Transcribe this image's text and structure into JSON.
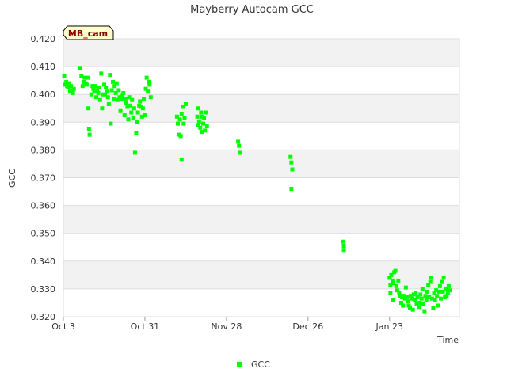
{
  "chart_data": {
    "type": "scatter",
    "title": "Mayberry Autocam GCC",
    "xlabel": "Time",
    "ylabel": "GCC",
    "tag_label": "MB_cam",
    "ylim": [
      0.32,
      0.42
    ],
    "yticks": [
      "0.420",
      "0.410",
      "0.400",
      "0.390",
      "0.380",
      "0.370",
      "0.360",
      "0.350",
      "0.340",
      "0.330",
      "0.320"
    ],
    "xlim_days": [
      0,
      136
    ],
    "xticks": [
      {
        "label": "Oct 3",
        "day": 0
      },
      {
        "label": "Oct 31",
        "day": 28
      },
      {
        "label": "Nov 28",
        "day": 56
      },
      {
        "label": "Dec 26",
        "day": 84
      },
      {
        "label": "Jan 23",
        "day": 112
      }
    ],
    "grid": true,
    "legend_position": "bottom",
    "series": [
      {
        "name": "GCC",
        "color": "#00ff00",
        "points": [
          [
            0.3,
            0.4065
          ],
          [
            0.6,
            0.4035
          ],
          [
            1.0,
            0.4045
          ],
          [
            1.3,
            0.403
          ],
          [
            1.6,
            0.4025
          ],
          [
            2.0,
            0.404
          ],
          [
            2.3,
            0.401
          ],
          [
            2.6,
            0.403
          ],
          [
            3.0,
            0.4015
          ],
          [
            3.3,
            0.4005
          ],
          [
            3.6,
            0.402
          ],
          [
            5.8,
            0.4095
          ],
          [
            6.2,
            0.4065
          ],
          [
            6.6,
            0.403
          ],
          [
            7.0,
            0.4045
          ],
          [
            7.3,
            0.406
          ],
          [
            7.7,
            0.404
          ],
          [
            8.0,
            0.4035
          ],
          [
            8.3,
            0.406
          ],
          [
            8.6,
            0.395
          ],
          [
            8.8,
            0.3875
          ],
          [
            9.0,
            0.3855
          ],
          [
            9.6,
            0.4
          ],
          [
            10.0,
            0.403
          ],
          [
            10.3,
            0.402
          ],
          [
            10.6,
            0.401
          ],
          [
            11.0,
            0.403
          ],
          [
            11.3,
            0.399
          ],
          [
            11.6,
            0.4015
          ],
          [
            12.0,
            0.4005
          ],
          [
            12.3,
            0.4025
          ],
          [
            12.6,
            0.398
          ],
          [
            13.0,
            0.4075
          ],
          [
            13.3,
            0.395
          ],
          [
            13.6,
            0.4
          ],
          [
            14.0,
            0.4035
          ],
          [
            14.3,
            0.4
          ],
          [
            14.6,
            0.4025
          ],
          [
            15.0,
            0.401
          ],
          [
            15.3,
            0.399
          ],
          [
            15.6,
            0.3965
          ],
          [
            16.0,
            0.407
          ],
          [
            16.3,
            0.3895
          ],
          [
            16.6,
            0.4015
          ],
          [
            17.0,
            0.4045
          ],
          [
            17.3,
            0.3985
          ],
          [
            17.6,
            0.403
          ],
          [
            18.0,
            0.4005
          ],
          [
            18.3,
            0.404
          ],
          [
            18.6,
            0.398
          ],
          [
            19.0,
            0.4015
          ],
          [
            19.3,
            0.399
          ],
          [
            19.6,
            0.394
          ],
          [
            20.0,
            0.3985
          ],
          [
            20.3,
            0.3995
          ],
          [
            20.6,
            0.4005
          ],
          [
            21.0,
            0.3925
          ],
          [
            21.3,
            0.3985
          ],
          [
            21.6,
            0.397
          ],
          [
            22.0,
            0.3955
          ],
          [
            22.3,
            0.391
          ],
          [
            22.6,
            0.399
          ],
          [
            23.0,
            0.396
          ],
          [
            23.3,
            0.3935
          ],
          [
            23.6,
            0.398
          ],
          [
            24.0,
            0.3915
          ],
          [
            24.3,
            0.395
          ],
          [
            24.6,
            0.379
          ],
          [
            25.0,
            0.386
          ],
          [
            25.3,
            0.39
          ],
          [
            25.6,
            0.3935
          ],
          [
            26.0,
            0.396
          ],
          [
            26.3,
            0.3975
          ],
          [
            26.6,
            0.3955
          ],
          [
            27.0,
            0.392
          ],
          [
            27.3,
            0.395
          ],
          [
            27.6,
            0.3985
          ],
          [
            28.0,
            0.3925
          ],
          [
            28.3,
            0.402
          ],
          [
            28.6,
            0.406
          ],
          [
            29.0,
            0.401
          ],
          [
            29.3,
            0.4045
          ],
          [
            29.6,
            0.4035
          ],
          [
            30.0,
            0.399
          ],
          [
            39.0,
            0.392
          ],
          [
            39.3,
            0.3895
          ],
          [
            39.6,
            0.3855
          ],
          [
            40.0,
            0.391
          ],
          [
            40.3,
            0.385
          ],
          [
            40.6,
            0.393
          ],
          [
            41.0,
            0.3955
          ],
          [
            41.3,
            0.3895
          ],
          [
            41.6,
            0.3915
          ],
          [
            42.0,
            0.3965
          ],
          [
            40.6,
            0.3765
          ],
          [
            46.0,
            0.392
          ],
          [
            46.3,
            0.395
          ],
          [
            46.6,
            0.39
          ],
          [
            47.0,
            0.388
          ],
          [
            47.3,
            0.3935
          ],
          [
            47.6,
            0.3865
          ],
          [
            48.0,
            0.3895
          ],
          [
            48.3,
            0.3915
          ],
          [
            48.6,
            0.387
          ],
          [
            49.0,
            0.3935
          ],
          [
            49.3,
            0.3885
          ],
          [
            46.3,
            0.389
          ],
          [
            47.6,
            0.392
          ],
          [
            60.0,
            0.383
          ],
          [
            60.3,
            0.3815
          ],
          [
            60.6,
            0.379
          ],
          [
            78.0,
            0.3775
          ],
          [
            78.3,
            0.3755
          ],
          [
            78.6,
            0.373
          ],
          [
            78.3,
            0.366
          ],
          [
            96.0,
            0.347
          ],
          [
            96.3,
            0.3455
          ],
          [
            96.3,
            0.344
          ],
          [
            112.0,
            0.334
          ],
          [
            112.3,
            0.3315
          ],
          [
            112.6,
            0.335
          ],
          [
            113.0,
            0.333
          ],
          [
            113.3,
            0.332
          ],
          [
            113.6,
            0.336
          ],
          [
            114.0,
            0.3365
          ],
          [
            114.3,
            0.331
          ],
          [
            114.6,
            0.3295
          ],
          [
            115.0,
            0.333
          ],
          [
            115.3,
            0.3285
          ],
          [
            115.6,
            0.3275
          ],
          [
            112.3,
            0.3285
          ],
          [
            113.3,
            0.326
          ],
          [
            116.0,
            0.325
          ],
          [
            116.3,
            0.327
          ],
          [
            116.6,
            0.324
          ],
          [
            117.0,
            0.3275
          ],
          [
            117.3,
            0.3265
          ],
          [
            117.6,
            0.3305
          ],
          [
            118.0,
            0.327
          ],
          [
            118.3,
            0.3255
          ],
          [
            118.6,
            0.324
          ],
          [
            119.0,
            0.323
          ],
          [
            119.3,
            0.3275
          ],
          [
            119.6,
            0.3265
          ],
          [
            120.0,
            0.3225
          ],
          [
            120.3,
            0.328
          ],
          [
            120.6,
            0.326
          ],
          [
            121.0,
            0.3285
          ],
          [
            121.3,
            0.3245
          ],
          [
            121.6,
            0.327
          ],
          [
            122.0,
            0.3235
          ],
          [
            122.3,
            0.325
          ],
          [
            122.6,
            0.328
          ],
          [
            123.0,
            0.3265
          ],
          [
            123.3,
            0.33
          ],
          [
            123.6,
            0.3245
          ],
          [
            124.0,
            0.322
          ],
          [
            124.3,
            0.3275
          ],
          [
            124.6,
            0.326
          ],
          [
            125.0,
            0.329
          ],
          [
            125.3,
            0.3315
          ],
          [
            125.6,
            0.327
          ],
          [
            126.0,
            0.3325
          ],
          [
            126.3,
            0.334
          ],
          [
            126.6,
            0.3265
          ],
          [
            127.0,
            0.323
          ],
          [
            127.3,
            0.3285
          ],
          [
            127.6,
            0.326
          ],
          [
            128.0,
            0.3295
          ],
          [
            128.3,
            0.3275
          ],
          [
            128.6,
            0.324
          ],
          [
            129.0,
            0.329
          ],
          [
            129.3,
            0.331
          ],
          [
            129.6,
            0.3265
          ],
          [
            130.0,
            0.3325
          ],
          [
            130.3,
            0.329
          ],
          [
            130.6,
            0.334
          ],
          [
            131.0,
            0.327
          ],
          [
            131.3,
            0.33
          ],
          [
            131.6,
            0.3275
          ],
          [
            132.0,
            0.3285
          ],
          [
            132.3,
            0.331
          ],
          [
            132.6,
            0.3295
          ]
        ]
      }
    ]
  }
}
